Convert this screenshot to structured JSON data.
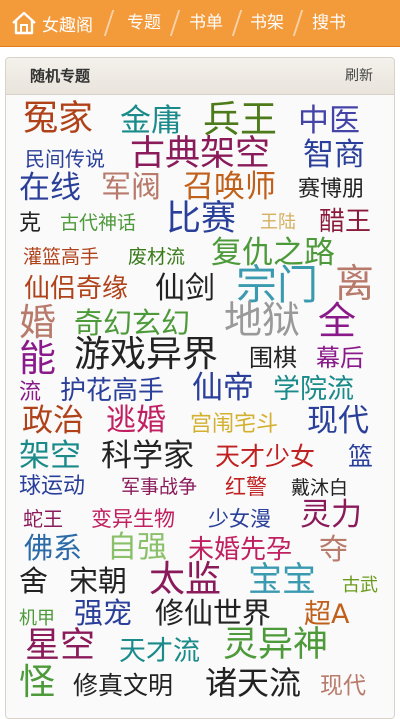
{
  "nav": {
    "home_label": "女趣阁",
    "items": [
      "专题",
      "书单",
      "书架",
      "搜书"
    ]
  },
  "panel": {
    "title": "随机专题",
    "refresh_label": "刷新"
  },
  "tags": [
    "冤家",
    "金庸",
    "兵王",
    "中医",
    "民间传说",
    "古典架空",
    "智商",
    "在线",
    "军阀",
    "召唤师",
    "赛博朋",
    "克",
    "古代神话",
    "比赛",
    "王陆",
    "醋王",
    "灌篮高手",
    "废材流",
    "复仇之路",
    "仙侣奇缘",
    "仙剑",
    "宗门",
    "离",
    "婚",
    "奇幻玄幻",
    "地狱",
    "全",
    "能",
    "游戏异界",
    "围棋",
    "幕后",
    "流",
    "护花高手",
    "仙帝",
    "学院流",
    "政治",
    "逃婚",
    "宫闱宅斗",
    "现代",
    "架空",
    "科学家",
    "天才少女",
    "篮",
    "球运动",
    "军事战争",
    "红警",
    "戴沐白",
    "蛇王",
    "变异生物",
    "少女漫",
    "灵力",
    "佛系",
    "自强",
    "未婚先孕",
    "夺",
    "舍",
    "宋朝",
    "太监",
    "宝宝",
    "古武",
    "机甲",
    "强宠",
    "修仙世界",
    "超A",
    "星空",
    "天才流",
    "灵异神",
    "怪",
    "修真文明",
    "诸天流",
    "现代"
  ]
}
